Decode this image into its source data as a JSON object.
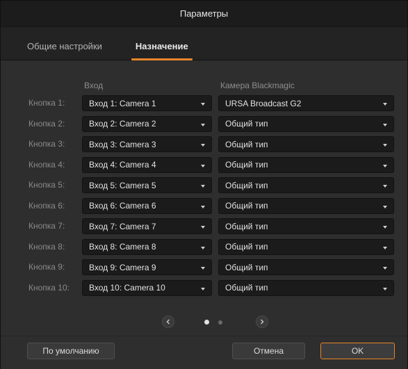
{
  "window": {
    "title": "Параметры"
  },
  "tabs": [
    {
      "label": "Общие настройки",
      "active": false
    },
    {
      "label": "Назначение",
      "active": true
    }
  ],
  "columns": {
    "input": "Вход",
    "camera": "Камера Blackmagic"
  },
  "rows": [
    {
      "label": "Кнопка 1:",
      "input": "Вход 1: Camera 1",
      "camera": "URSA Broadcast G2"
    },
    {
      "label": "Кнопка 2:",
      "input": "Вход 2: Camera 2",
      "camera": "Общий тип"
    },
    {
      "label": "Кнопка 3:",
      "input": "Вход 3: Camera 3",
      "camera": "Общий тип"
    },
    {
      "label": "Кнопка 4:",
      "input": "Вход 4: Camera 4",
      "camera": "Общий тип"
    },
    {
      "label": "Кнопка 5:",
      "input": "Вход 5: Camera 5",
      "camera": "Общий тип"
    },
    {
      "label": "Кнопка 6:",
      "input": "Вход 6: Camera 6",
      "camera": "Общий тип"
    },
    {
      "label": "Кнопка 7:",
      "input": "Вход 7: Camera 7",
      "camera": "Общий тип"
    },
    {
      "label": "Кнопка 8:",
      "input": "Вход 8: Camera 8",
      "camera": "Общий тип"
    },
    {
      "label": "Кнопка 9:",
      "input": "Вход 9: Camera 9",
      "camera": "Общий тип"
    },
    {
      "label": "Кнопка 10:",
      "input": "Вход 10: Camera 10",
      "camera": "Общий тип"
    }
  ],
  "pager": {
    "current_page": 1,
    "total_pages": 2
  },
  "buttons": {
    "default": "По умолчанию",
    "cancel": "Отмена",
    "ok": "OK"
  },
  "colors": {
    "accent": "#e8862c",
    "background": "#2e2e2e",
    "field": "#1b1b1b"
  },
  "icons": {
    "prev": "chevron-left-icon",
    "next": "chevron-right-icon",
    "dropdown": "caret-down-icon"
  }
}
